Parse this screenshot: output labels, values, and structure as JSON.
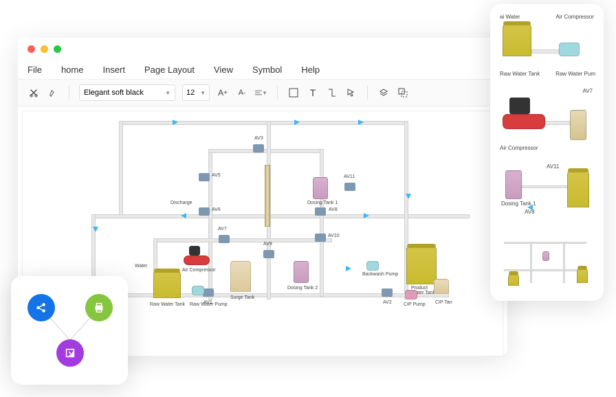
{
  "menu": [
    "File",
    "home",
    "Insert",
    "Page Layout",
    "View",
    "Symbol",
    "Help"
  ],
  "toolbar": {
    "font": "Elegant soft black",
    "size": "12"
  },
  "canvas": {
    "labels": {
      "water": "Water",
      "rawWaterTank": "Raw Water Tank",
      "rawWaterPump": "Raw Water Pump",
      "airCompressor": "Air Compressor",
      "surgeTank": "Surge Tank",
      "dosingTank1": "Dosing Tank 1",
      "dosingTank2": "Dosing Tank 2",
      "backwashPump": "Backwash Pump",
      "productWaterTank": "Product Water Tank",
      "cipPump": "CIP Pump",
      "cipTan": "CIP Tan",
      "discharge": "Discharge"
    },
    "valves": {
      "av1": "AV1",
      "av2": "AV2",
      "av3": "AV3",
      "av5": "AV5",
      "av6": "AV6",
      "av7": "AV7",
      "av8": "AV8",
      "av9": "AV9",
      "av10": "AV10",
      "av11": "AV11"
    }
  },
  "thumbnails": [
    {
      "topLeft": "ai Water",
      "topRight": "Air Compressor",
      "bottomLeft": "Raw Water Tank",
      "bottomRight": "Raw Water Pum"
    },
    {
      "topRight": "AV7",
      "bottomLeft": "Air Compressor"
    },
    {
      "dosing": "Dosing Tank 1",
      "av11": "AV11",
      "av8": "AV8"
    },
    {}
  ]
}
